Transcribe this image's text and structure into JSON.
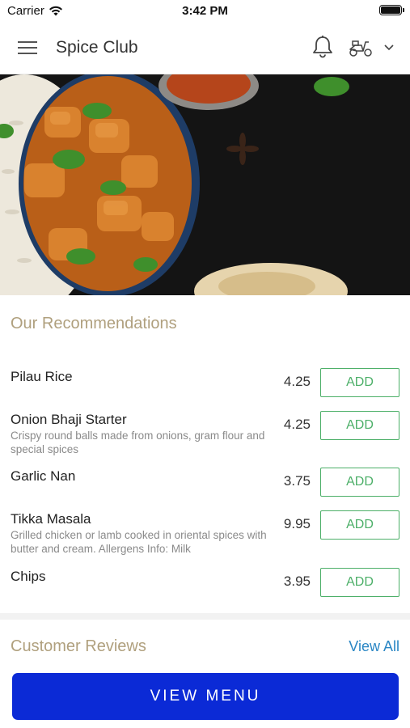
{
  "status_bar": {
    "carrier": "Carrier",
    "time": "3:42 PM"
  },
  "header": {
    "title": "Spice Club"
  },
  "recommendations": {
    "title": "Our Recommendations",
    "add_label": "ADD",
    "items": [
      {
        "name": "Pilau Rice",
        "description": "",
        "price": "4.25"
      },
      {
        "name": "Onion Bhaji Starter",
        "description": "Crispy round balls made from onions, gram flour and special spices",
        "price": "4.25"
      },
      {
        "name": "Garlic Nan",
        "description": "",
        "price": "3.75"
      },
      {
        "name": "Tikka Masala",
        "description": "Grilled chicken or lamb cooked in oriental spices with butter and cream. Allergens Info: Milk",
        "price": "9.95"
      },
      {
        "name": "Chips",
        "description": "",
        "price": "3.95"
      }
    ]
  },
  "reviews": {
    "title": "Customer Reviews",
    "view_all": "View All"
  },
  "footer": {
    "view_menu": "VIEW MENU"
  },
  "colors": {
    "accent_tan": "#b0a07e",
    "add_green": "#4caf68",
    "link_blue": "#2a86c4",
    "primary_blue": "#0b2ad6"
  },
  "icons": [
    "menu-icon",
    "bell-icon",
    "scooter-icon",
    "chevron-down-icon",
    "wifi-icon",
    "battery-icon"
  ]
}
